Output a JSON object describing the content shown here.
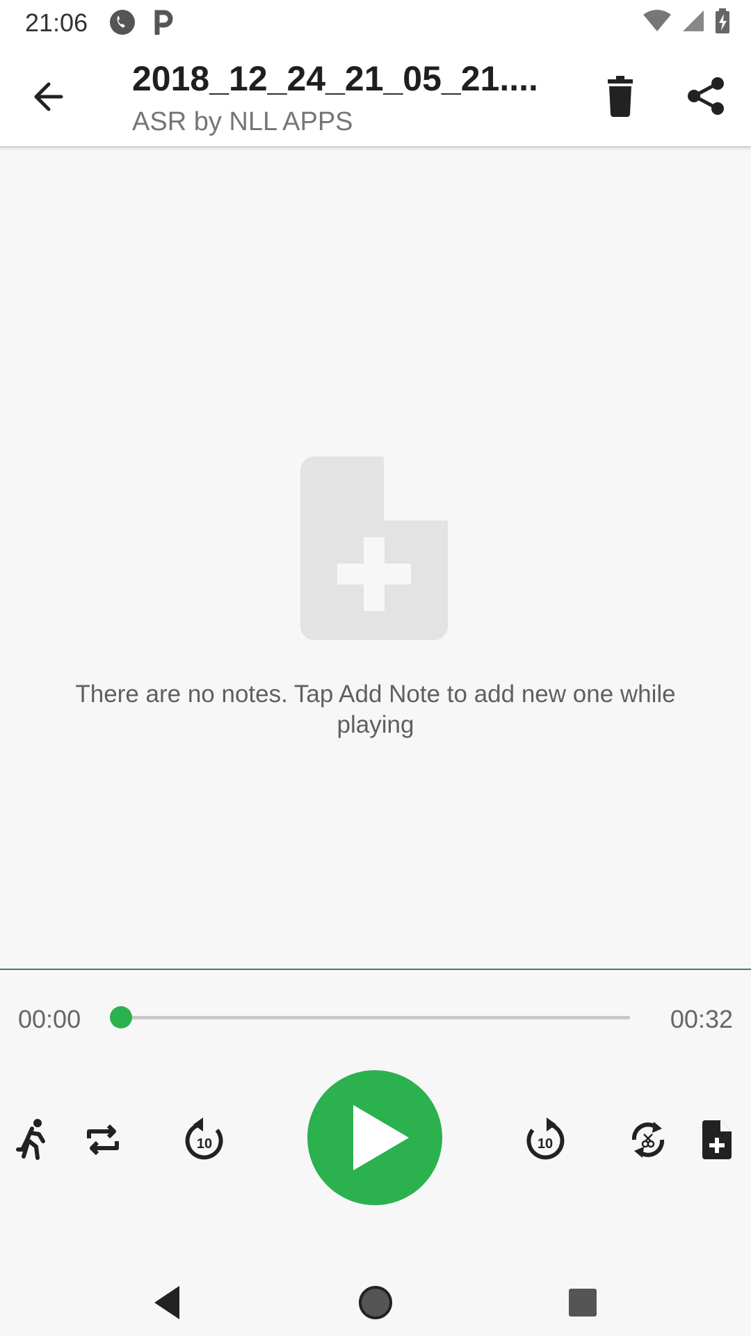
{
  "status_bar": {
    "time": "21:06",
    "left_icons": [
      "phone-icon",
      "parking-icon"
    ],
    "right_icons": [
      "wifi-icon",
      "signal-icon",
      "battery-charging-icon"
    ]
  },
  "app_bar": {
    "title": "2018_12_24_21_05_21....",
    "subtitle": "ASR by NLL APPS",
    "actions": [
      "delete-icon",
      "share-icon"
    ]
  },
  "empty_state": {
    "icon": "note-add-icon",
    "message": "There are no notes. Tap Add Note to add new one while playing"
  },
  "player": {
    "current_time": "00:00",
    "total_time": "00:32",
    "progress": 0,
    "accent_color": "#2bb14e",
    "controls": [
      "playback-speed-icon",
      "repeat-icon",
      "rewind-10-icon",
      "play-icon",
      "forward-10-icon",
      "skip-silence-icon",
      "add-note-icon"
    ]
  },
  "nav_bar": {
    "buttons": [
      "back-triangle-icon",
      "home-circle-icon",
      "recents-square-icon"
    ]
  }
}
